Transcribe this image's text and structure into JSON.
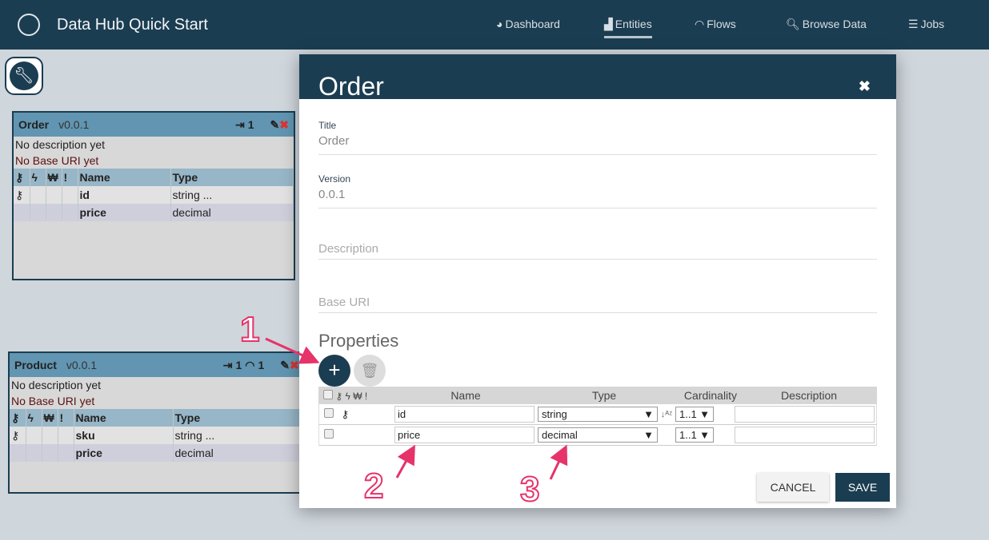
{
  "app": {
    "title": "Data Hub Quick Start"
  },
  "nav": [
    {
      "label": "Dashboard",
      "icon": "dashboard-icon"
    },
    {
      "label": "Entities",
      "icon": "factory-icon"
    },
    {
      "label": "Flows",
      "icon": "flows-icon"
    },
    {
      "label": "Browse Data",
      "icon": "search-icon"
    },
    {
      "label": "Jobs",
      "icon": "jobs-icon"
    }
  ],
  "cards": [
    {
      "name": "Order",
      "version": "v0.0.1",
      "count": "1",
      "desc": "No description yet",
      "uri": "No Base URI yet",
      "rows": [
        {
          "name": "id",
          "type": "string ..."
        },
        {
          "name": "price",
          "type": "decimal"
        }
      ]
    },
    {
      "name": "Product",
      "version": "v0.0.1",
      "count": "1",
      "flows": "1",
      "desc": "No description yet",
      "uri": "No Base URI yet",
      "rows": [
        {
          "name": "sku",
          "type": "string ..."
        },
        {
          "name": "price",
          "type": "decimal"
        }
      ]
    }
  ],
  "card_headers": {
    "name": "Name",
    "type": "Type"
  },
  "modal": {
    "title": "Order",
    "close": "✖",
    "title_label": "Title",
    "title_value": "Order",
    "version_label": "Version",
    "version_value": "0.0.1",
    "description_placeholder": "Description",
    "baseuri_placeholder": "Base URI",
    "properties": "Properties",
    "columns": {
      "name": "Name",
      "type": "Type",
      "cardinality": "Cardinality",
      "description": "Description"
    },
    "rows": [
      {
        "name": "id",
        "type": "string",
        "cardinality": "1..1",
        "key": true
      },
      {
        "name": "price",
        "type": "decimal",
        "cardinality": "1..1",
        "key": false
      }
    ],
    "cancel": "CANCEL",
    "save": "SAVE"
  },
  "annotations": [
    "1",
    "2",
    "3"
  ],
  "colors": {
    "header": "#1b3d51",
    "card_header": "#6195b1",
    "accent": "#e6336a"
  }
}
